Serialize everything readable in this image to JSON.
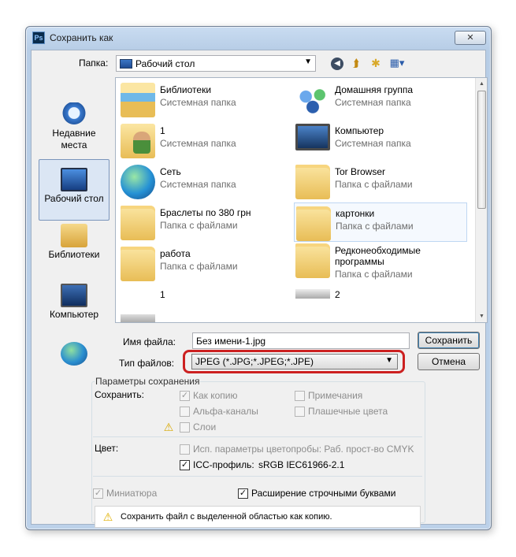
{
  "window": {
    "title": "Сохранить как",
    "app_icon": "ps-icon",
    "close_glyph": "✕"
  },
  "toolbar": {
    "lookin_label": "Папка:",
    "lookin_value": "Рабочий стол",
    "icons": [
      "back-arrow-icon",
      "up-folder-icon",
      "new-folder-icon",
      "views-menu-icon"
    ]
  },
  "places": [
    {
      "label": "Недавние места",
      "icon": "recent-places-icon"
    },
    {
      "label": "Рабочий стол",
      "icon": "desktop-icon",
      "selected": true
    },
    {
      "label": "Библиотеки",
      "icon": "libraries-icon"
    },
    {
      "label": "Компьютер",
      "icon": "computer-icon"
    },
    {
      "label": "",
      "icon": "network-icon"
    }
  ],
  "files": [
    {
      "name": "Библиотеки",
      "type": "Системная папка",
      "icon": "libraries-icon"
    },
    {
      "name": "Домашняя группа",
      "type": "Системная папка",
      "icon": "homegroup-icon"
    },
    {
      "name": "1",
      "type": "Системная папка",
      "icon": "user-folder-icon"
    },
    {
      "name": "Компьютер",
      "type": "Системная папка",
      "icon": "computer-icon"
    },
    {
      "name": "Сеть",
      "type": "Системная папка",
      "icon": "network-icon"
    },
    {
      "name": "Tor Browser",
      "type": "Папка с файлами",
      "icon": "folder-icon"
    },
    {
      "name": "Браслеты по 380 грн",
      "type": "Папка с файлами",
      "icon": "folder-icon"
    },
    {
      "name": "картонки",
      "type": "Папка с файлами",
      "icon": "folder-icon",
      "selected": true
    },
    {
      "name": "работа",
      "type": "Папка с файлами",
      "icon": "folder-icon"
    },
    {
      "name": "Редконеобходимые программы",
      "type": "Папка с файлами",
      "icon": "folder-icon"
    },
    {
      "name": "1",
      "type": "",
      "icon": "image-file-icon"
    },
    {
      "name": "2",
      "type": "",
      "icon": "image-file-icon"
    }
  ],
  "filename": {
    "label": "Имя файла:",
    "value": "Без имени-1.jpg"
  },
  "filetype": {
    "label": "Тип файлов:",
    "value": "JPEG (*.JPG;*.JPEG;*.JPE)"
  },
  "buttons": {
    "save": "Сохранить",
    "cancel": "Отмена"
  },
  "save_options": {
    "legend": "Параметры сохранения",
    "save_label": "Сохранить:",
    "as_copy": {
      "label": "Как копию",
      "checked": true
    },
    "notes": {
      "label": "Примечания",
      "checked": false
    },
    "alpha": {
      "label": "Альфа-каналы",
      "checked": false
    },
    "spot": {
      "label": "Плашечные цвета",
      "checked": false
    },
    "layers": {
      "label": "Слои",
      "checked": false
    },
    "color_label": "Цвет:",
    "proof": {
      "label": "Исп. параметры цветопробы:  Раб. прост-во CMYK",
      "checked": false
    },
    "icc": {
      "label": "ICC-профиль:",
      "value": "sRGB IEC61966-2.1",
      "checked": true
    },
    "thumbnail": {
      "label": "Миниатюра",
      "checked": true
    },
    "lowercase": {
      "label": "Расширение строчными буквами",
      "checked": true
    },
    "message": "Сохранить файл с выделенной областью как копию."
  },
  "colors": {
    "accent": "#3c7fb1",
    "highlight_ring": "#cc2020",
    "selection": "#dbe6f4"
  }
}
